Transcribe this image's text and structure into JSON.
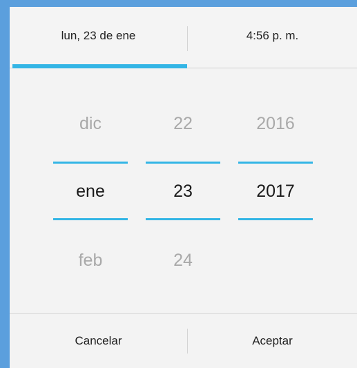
{
  "tabs": {
    "date_label": "lun, 23 de ene",
    "time_label": "4:56 p. m.",
    "selected": "date"
  },
  "month_picker": {
    "prev": "dic",
    "current": "ene",
    "next": "feb"
  },
  "day_picker": {
    "prev": "22",
    "current": "23",
    "next": "24"
  },
  "year_picker": {
    "prev": "2016",
    "current": "2017",
    "next": ""
  },
  "buttons": {
    "cancel_label": "Cancelar",
    "accept_label": "Aceptar"
  },
  "colors": {
    "accent": "#33b5e5",
    "window_border": "#5b9fdd",
    "background": "#f3f3f3"
  }
}
